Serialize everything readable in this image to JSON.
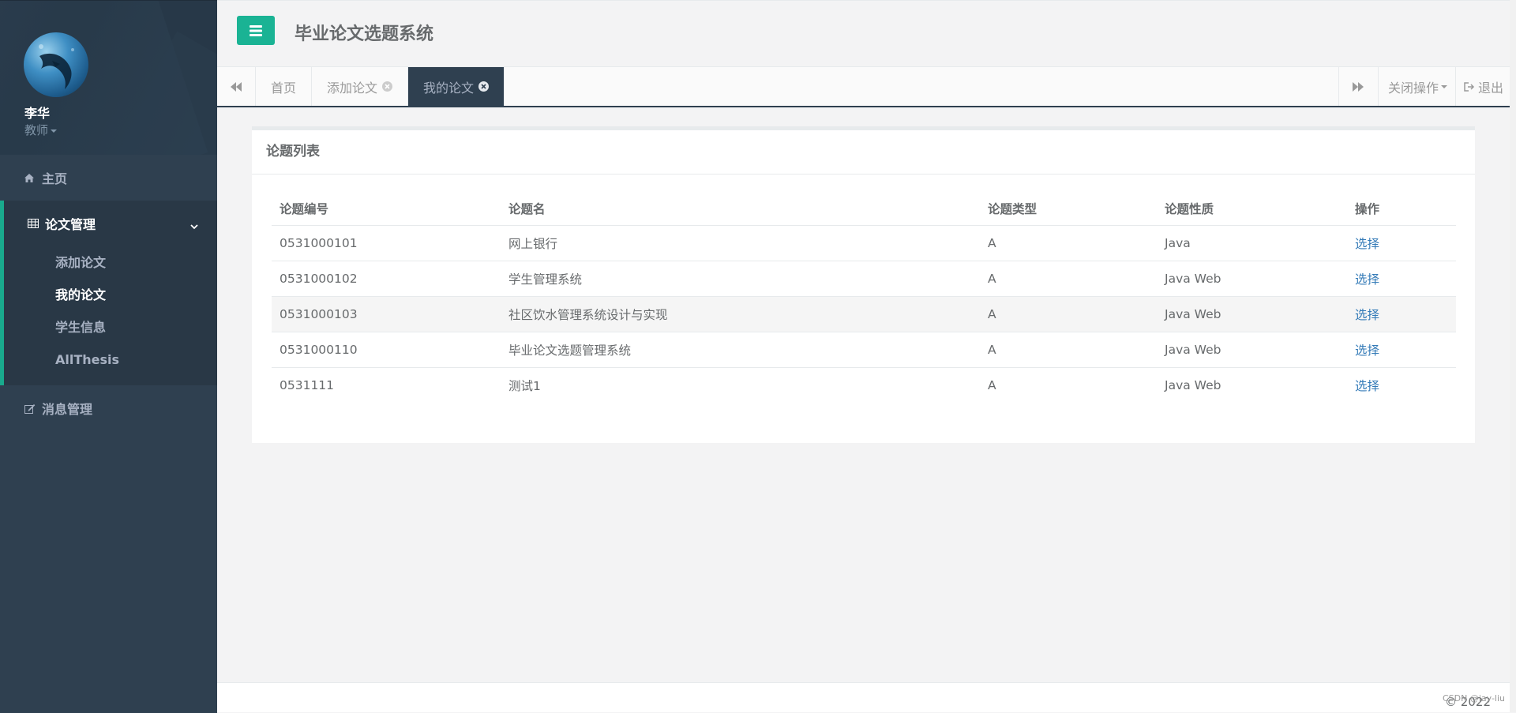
{
  "user": {
    "name": "李华",
    "role": "教师"
  },
  "sidebar": {
    "home": "主页",
    "thesis_group": {
      "label": "论文管理",
      "items": [
        {
          "label": "添加论文",
          "active": false
        },
        {
          "label": "我的论文",
          "active": true
        },
        {
          "label": "学生信息",
          "active": false
        },
        {
          "label": "AllThesis",
          "active": false
        }
      ]
    },
    "messages": "消息管理"
  },
  "header": {
    "title": "毕业论文选题系统"
  },
  "tabs": [
    {
      "label": "首页"
    },
    {
      "label": "添加论文"
    },
    {
      "label": "我的论文"
    }
  ],
  "tab_actions": {
    "close_ops": "关闭操作",
    "logout": "退出"
  },
  "panel": {
    "title": "论题列表",
    "columns": [
      "论题编号",
      "论题名",
      "论题类型",
      "论题性质",
      "操作"
    ],
    "rows": [
      {
        "id": "0531000101",
        "name": "网上银行",
        "type": "A",
        "nature": "Java",
        "action": "选择"
      },
      {
        "id": "0531000102",
        "name": "学生管理系统",
        "type": "A",
        "nature": "Java Web",
        "action": "选择"
      },
      {
        "id": "0531000103",
        "name": "社区饮水管理系统设计与实现",
        "type": "A",
        "nature": "Java Web",
        "action": "选择"
      },
      {
        "id": "0531000110",
        "name": "毕业论文选题管理系统",
        "type": "A",
        "nature": "Java Web",
        "action": "选择"
      },
      {
        "id": "0531111",
        "name": "测试1",
        "type": "A",
        "nature": "Java Web",
        "action": "选择"
      }
    ]
  },
  "footer": {
    "copyright": "© 2022",
    "watermark": "CSDN @jay-liu"
  },
  "colors": {
    "accent": "#1ab394",
    "sidebar": "#2f4050",
    "link": "#337ab7"
  }
}
